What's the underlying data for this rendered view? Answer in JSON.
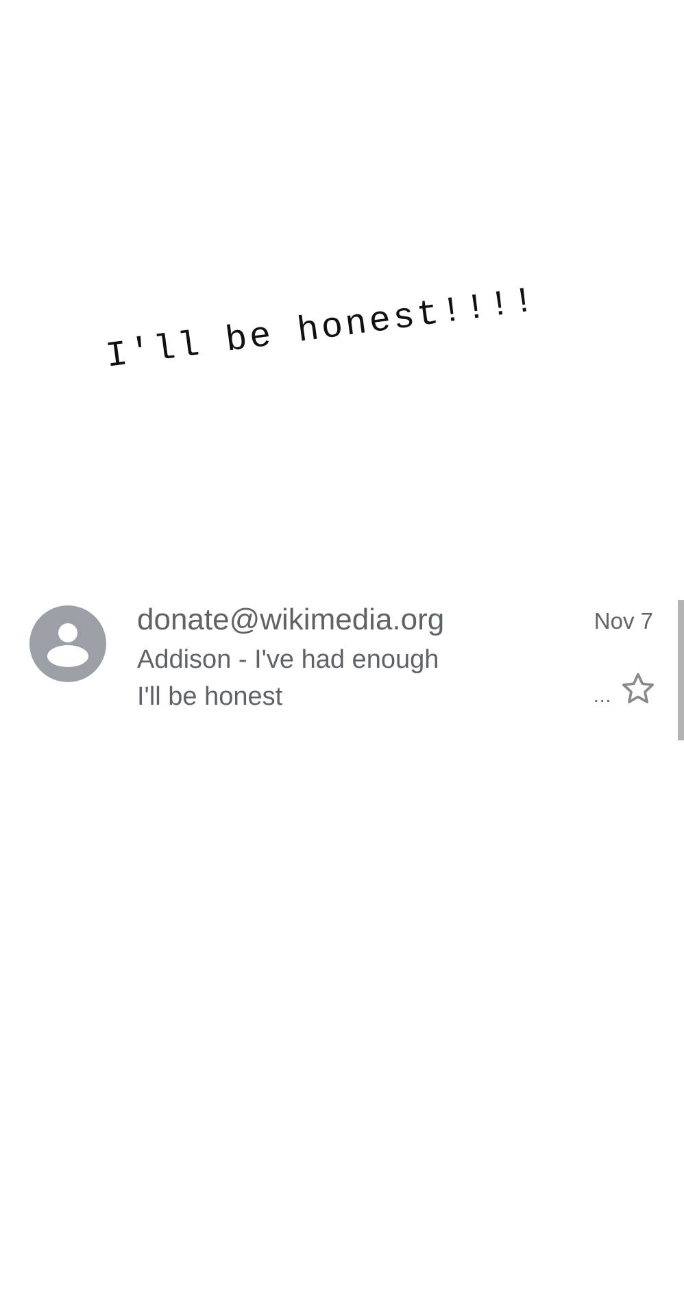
{
  "caption": {
    "text": "I'll be honest!!!!"
  },
  "email": {
    "sender": "donate@wikimedia.org",
    "subject": "Addison - I've had enough",
    "snippet": "I'll be honest",
    "date": "Nov 7",
    "more_indicator": "...",
    "starred": false,
    "avatar_icon": "person-icon",
    "star_icon": "star-outline-icon"
  },
  "colors": {
    "text_gray": "#5f6368",
    "avatar_gray": "#9aa0a6",
    "caption_black": "#111111",
    "scrollbar": "#b3b3b3"
  }
}
